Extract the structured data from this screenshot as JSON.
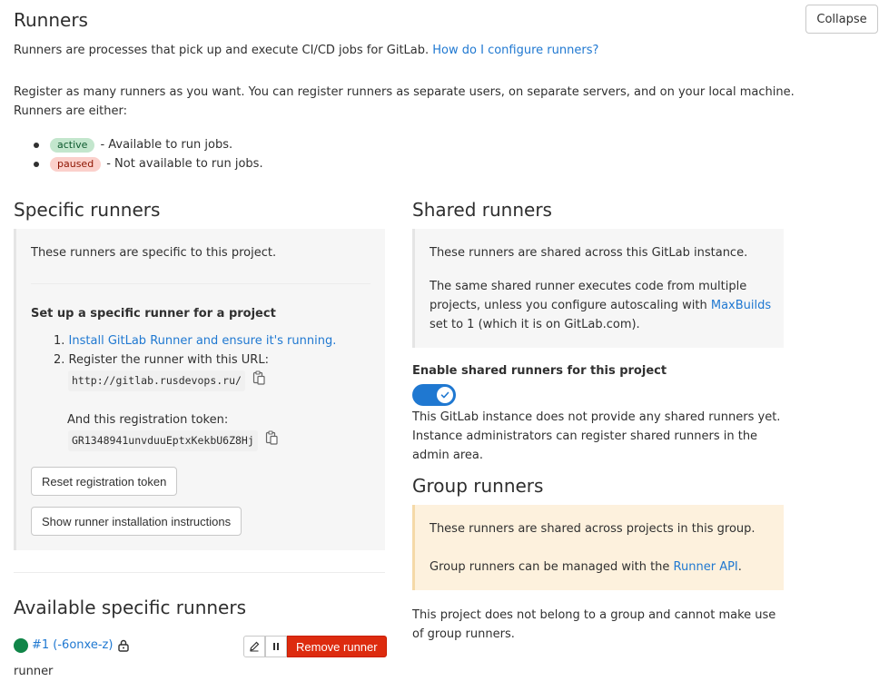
{
  "header": {
    "title": "Runners",
    "collapse_label": "Collapse"
  },
  "intro": {
    "text": "Runners are processes that pick up and execute CI/CD jobs for GitLab.",
    "help_link": "How do I configure runners?",
    "register_text": "Register as many runners as you want. You can register runners as separate users, on separate servers, and on your local machine. Runners are either:",
    "states": [
      {
        "badge": "active",
        "text": "- Available to run jobs."
      },
      {
        "badge": "paused",
        "text": "- Not available to run jobs."
      }
    ]
  },
  "specific": {
    "title": "Specific runners",
    "box_text": "These runners are specific to this project.",
    "setup_title": "Set up a specific runner for a project",
    "step1_num": "1.",
    "step1_link": "Install GitLab Runner and ensure it's running.",
    "step2_num": "2.",
    "step2_text": "Register the runner with this URL:",
    "url": "http://gitlab.rusdevops.ru/",
    "token_label": "And this registration token:",
    "token": "GR1348941unvduuEptxKekbU6Z8Hj",
    "reset_button": "Reset registration token",
    "instructions_button": "Show runner installation instructions"
  },
  "available": {
    "title": "Available specific runners",
    "runner_id": "#1 (-6onxe-z)",
    "runner_desc": "runner",
    "remove_button": "Remove runner"
  },
  "shared": {
    "title": "Shared runners",
    "box_text1": "These runners are shared across this GitLab instance.",
    "box_text2_a": "The same shared runner executes code from multiple projects, unless you configure autoscaling with",
    "box_link": "MaxBuilds",
    "box_text2_b": "set to 1 (which it is on GitLab.com).",
    "enable_label": "Enable shared runners for this project",
    "toggle_state": "on",
    "no_runners_text": "This GitLab instance does not provide any shared runners yet. Instance administrators can register shared runners in the admin area."
  },
  "group": {
    "title": "Group runners",
    "box_text1": "These runners are shared across projects in this group.",
    "box_text2": "Group runners can be managed with the",
    "box_link": "Runner API",
    "box_period": ".",
    "footer_text": "This project does not belong to a group and cannot make use of group runners."
  },
  "colors": {
    "link": "#1f78d1",
    "active_badge_bg": "#c3e6cd",
    "paused_badge_bg": "#fbd0cb",
    "toggle_on": "#1f78d1",
    "remove_button": "#dd2b0e",
    "status_online": "#108548"
  }
}
